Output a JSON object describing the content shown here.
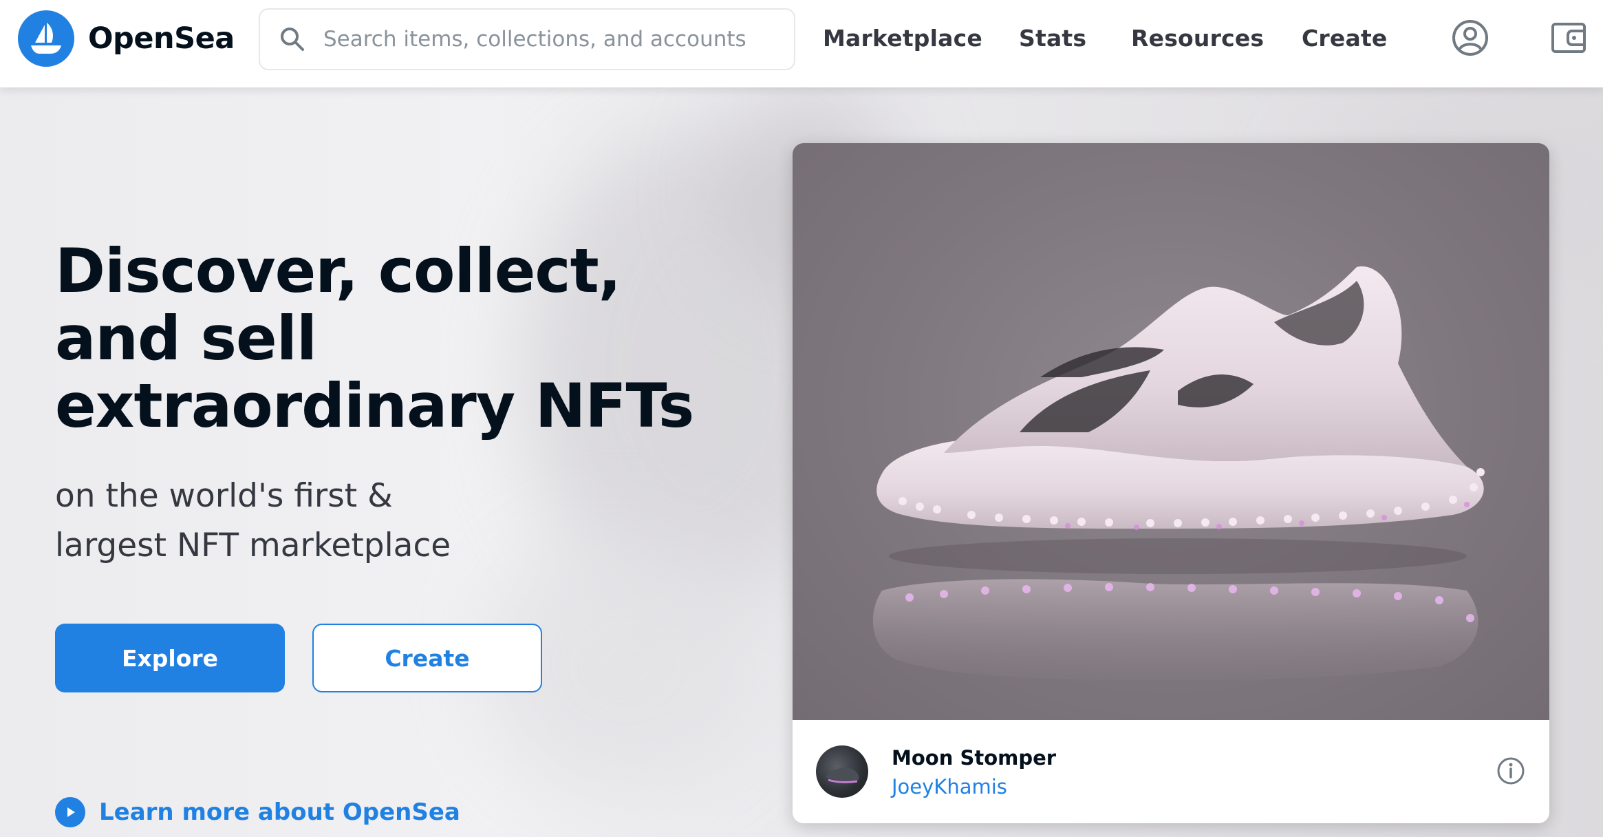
{
  "header": {
    "logo_text": "OpenSea",
    "search": {
      "placeholder": "Search items, collections, and accounts",
      "value": ""
    },
    "nav": [
      {
        "label": "Marketplace"
      },
      {
        "label": "Stats"
      },
      {
        "label": "Resources"
      },
      {
        "label": "Create"
      }
    ],
    "icons": [
      "account-icon",
      "wallet-icon"
    ]
  },
  "hero": {
    "headline": "Discover, collect, and sell extraordinary NFTs",
    "subline_1": "on the world's first &",
    "subline_2": "largest NFT marketplace",
    "explore_label": "Explore",
    "create_label": "Create",
    "learn_more_label": "Learn more about OpenSea"
  },
  "featured": {
    "name": "Moon Stomper",
    "creator": "JoeyKhamis",
    "image": "shoe-render"
  },
  "colors": {
    "accent": "#2081e2",
    "text_dark": "#04111d",
    "text_muted": "#353840",
    "card_image_bg": "#7f777e"
  }
}
